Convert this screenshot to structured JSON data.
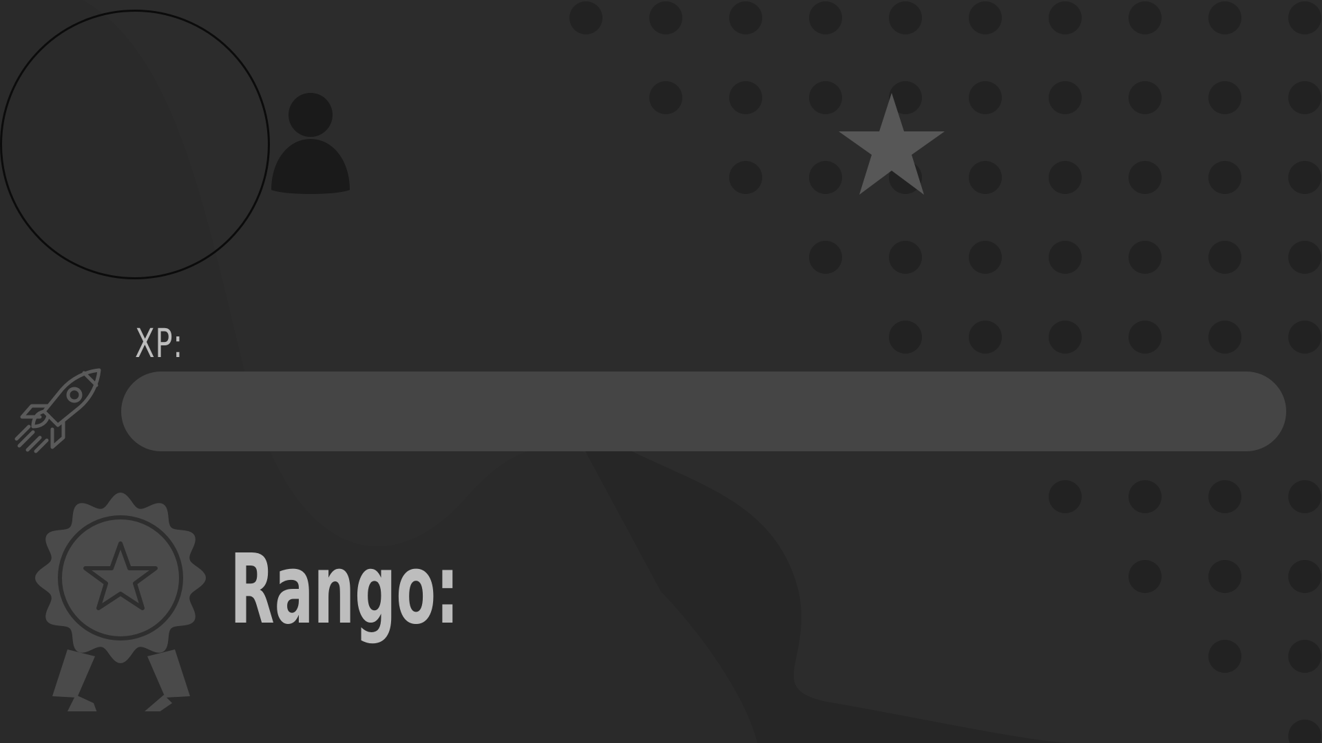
{
  "profile": {
    "avatar_icon": "user-icon",
    "decoration_icon": "star-icon"
  },
  "xp": {
    "label": "XP:",
    "icon": "rocket-icon",
    "progress": 0
  },
  "rank": {
    "label": "Rango:",
    "icon": "award-badge-icon"
  },
  "colors": {
    "background": "#2a2a2a",
    "dots": "#222222",
    "bar_track": "#454545",
    "label_text": "#bdbdbd",
    "icon_gray": "#5a5a5a"
  }
}
